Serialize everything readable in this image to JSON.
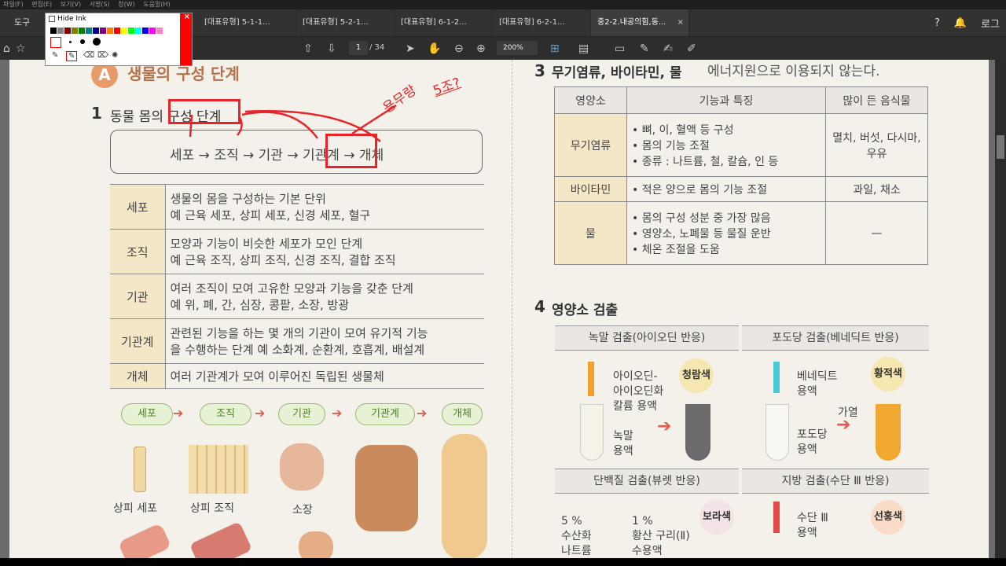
{
  "menu": [
    "파일(F)",
    "편집(E)",
    "보기(V)",
    "서명(S)",
    "창(W)",
    "도움말(H)"
  ],
  "tools_label": "도구",
  "tabs": [
    "[대표유형] 5-1-1...",
    "[대표유형] 5-2-1...",
    "[대표유형] 6-1-2...",
    "[대표유형] 6-2-1...",
    "중2-2.내공의힘,동..."
  ],
  "topright": {
    "help_icon": "?",
    "more_label": "로그"
  },
  "toolbar": {
    "page_current": "1",
    "page_total": "/ 34",
    "zoom": "200%"
  },
  "ink_panel": {
    "hide_label": "Hide Ink",
    "colors": [
      "#000000",
      "#808080",
      "#800000",
      "#808000",
      "#008000",
      "#008080",
      "#000080",
      "#800080",
      "#ff8000",
      "#ff0000",
      "#ffff00",
      "#00ff00",
      "#00ffff",
      "#0000ff",
      "#ff00ff",
      "#ff80c0"
    ]
  },
  "annotations": {
    "note1": "용무랑",
    "note2": "5조?",
    "accent": "#e8242b"
  },
  "doc": {
    "section_A_badge": "A",
    "section_A_title": "생물의 구성 단계",
    "s1_num": "1",
    "s1_title": "동물 몸의 구성 단계",
    "flow": "세포 → 조직 → 기관 → 기관계 → 개체",
    "levels": [
      {
        "k": "세포",
        "l1": "생물의 몸을 구성하는 기본 단위",
        "l2": "예 근육 세포, 상피 세포, 신경 세포, 혈구"
      },
      {
        "k": "조직",
        "l1": "모양과 기능이 비슷한 세포가 모인 단계",
        "l2": "예 근육 조직, 상피 조직, 신경 조직, 결합 조직"
      },
      {
        "k": "기관",
        "l1": "여러 조직이 모여 고유한 모양과 기능을 갖춘 단계",
        "l2": "예 위, 폐, 간, 심장, 콩팥, 소장, 방광"
      },
      {
        "k": "기관계",
        "l1": "관련된 기능을 하는 몇 개의 기관이 모여 유기적 기능",
        "l2": "을 수행하는 단계 예 소화계, 순환계, 호흡계, 배설계"
      },
      {
        "k": "개체",
        "l1": "여러 기관계가 모여 이루어진 독립된 생물체",
        "l2": ""
      }
    ],
    "chips": [
      "세포",
      "조직",
      "기관",
      "기관계",
      "개체"
    ],
    "pic_labels": [
      "상피 세포",
      "상피 조직",
      "소장"
    ],
    "s3_num": "3",
    "s3_title": "무기염류, 바이타민, 물",
    "s3_title_rest": "에너지원으로 이용되지 않는다.",
    "t3_head": [
      "영양소",
      "기능과 특징",
      "많이 든 음식물"
    ],
    "t3_rows": [
      {
        "k": "무기염류",
        "lines": [
          "• 뼈, 이, 혈액 등 구성",
          "• 몸의 기능 조절",
          "• 종류 : 나트륨, 철, 칼슘, 인 등"
        ],
        "food": "멸치, 버섯, 다시마, 우유"
      },
      {
        "k": "바이타민",
        "lines": [
          "• 적은 양으로 몸의 기능 조절"
        ],
        "food": "과일, 채소"
      },
      {
        "k": "물",
        "lines": [
          "• 몸의 구성 성분 중 가장 많음",
          "• 영양소, 노폐물 등 물질 운반",
          "• 체온 조절을 도움"
        ],
        "food": "—"
      }
    ],
    "s4_num": "4",
    "s4_title": "영양소 검출",
    "detect": {
      "starch": {
        "title": "녹말 검출(아이오딘 반응)",
        "reagent": "아이오딘-\n아이오딘화\n칼륨 용액",
        "sample": "녹말\n용액",
        "result": "청람색"
      },
      "glucose": {
        "title": "포도당 검출(베네딕트 반응)",
        "reagent": "베네딕트\n용액",
        "sample": "포도당\n용액",
        "heat": "가열",
        "result": "황적색"
      },
      "protein": {
        "title": "단백질 검출(뷰렛 반응)",
        "r1": "5 %\n수산화\n나트륨",
        "r2": "1 %\n황산 구리(Ⅱ)\n수용액",
        "result": "보라색"
      },
      "fat": {
        "title": "지방 검출(수단 Ⅲ 반응)",
        "reagent": "수단 Ⅲ\n용액",
        "result": "선홍색"
      }
    }
  }
}
